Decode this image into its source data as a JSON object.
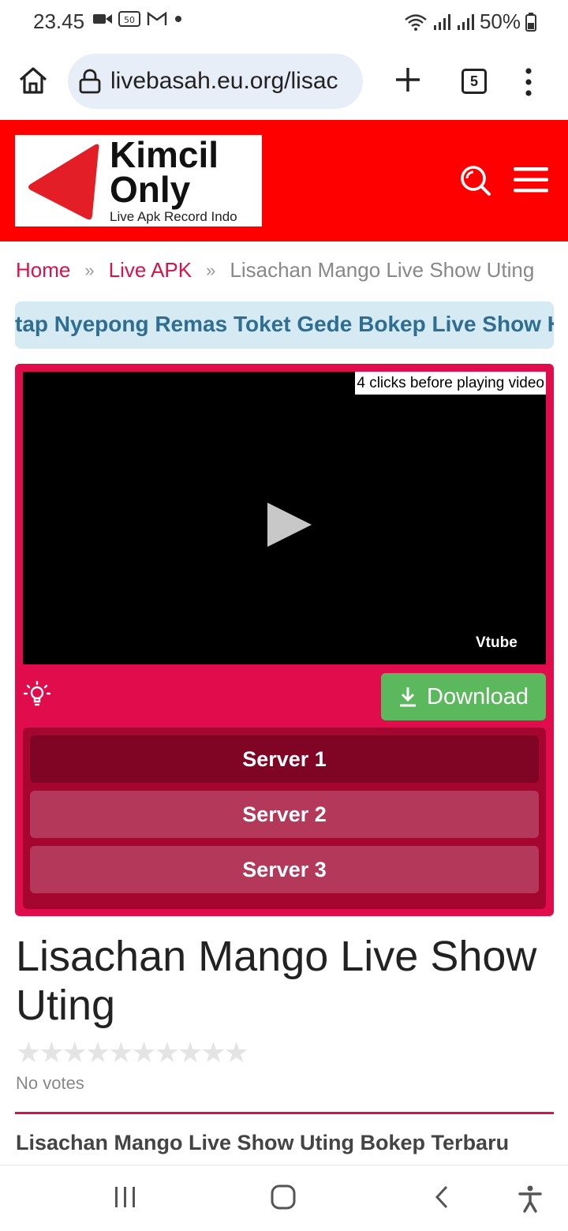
{
  "status_bar": {
    "time": "23.45",
    "battery": "50%",
    "icons": [
      "video-call-icon",
      "badge-50-icon",
      "gmail-icon",
      "dot-icon",
      "wifi-icon",
      "signal-icon",
      "battery-icon"
    ]
  },
  "browser": {
    "url": "livebasah.eu.org/lisac",
    "tab_count": "5"
  },
  "site": {
    "logo_line1": "Kimcil",
    "logo_line2": "Only",
    "logo_tagline": "Live Apk Record Indo",
    "header_color": "#ff0000"
  },
  "breadcrumb": {
    "home": "Home",
    "sep": "»",
    "category": "Live APK",
    "current": "Lisachan Mango Live Show Uting"
  },
  "marquee": {
    "text": "tap Nyepong Remas Toket Gede Bokep Live Show Host"
  },
  "player": {
    "click_note": "4 clicks before playing video",
    "watermark": "Vtube",
    "download_label": "Download",
    "servers": [
      {
        "label": "Server 1",
        "active": true
      },
      {
        "label": "Server 2",
        "active": false
      },
      {
        "label": "Server 3",
        "active": false
      }
    ],
    "accent": "#e10c4b",
    "download_color": "#5cb85c"
  },
  "post": {
    "title": "Lisachan Mango Live Show Uting",
    "rating_stars": 10,
    "rating_value": 0,
    "votes": "No votes",
    "subheading": "Lisachan Mango Live Show Uting Bokep Terbaru"
  }
}
